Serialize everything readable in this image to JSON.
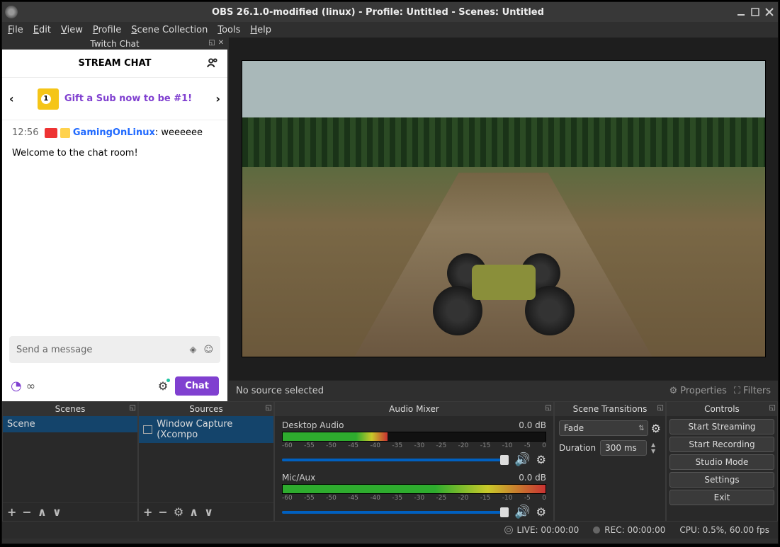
{
  "title": "OBS 26.1.0-modified (linux) - Profile: Untitled - Scenes: Untitled",
  "menu": {
    "file": "File",
    "edit": "Edit",
    "view": "View",
    "profile": "Profile",
    "scene": "Scene Collection",
    "tools": "Tools",
    "help": "Help"
  },
  "twitch": {
    "dock_title": "Twitch Chat",
    "header": "STREAM CHAT",
    "promo": "Gift a Sub now to be #1!",
    "msg_time": "12:56",
    "msg_user": "GamingOnLinux",
    "msg_text": ": weeeeee",
    "welcome": "Welcome to the chat room!",
    "input_ph": "Send a message",
    "chat_btn": "Chat",
    "infinity": "∞"
  },
  "srcbar": {
    "no_src": "No source selected",
    "props": "Properties",
    "filters": "Filters"
  },
  "panels": {
    "scenes": {
      "title": "Scenes",
      "item": "Scene"
    },
    "sources": {
      "title": "Sources",
      "item": "Window Capture (Xcompo"
    },
    "mixer": {
      "title": "Audio Mixer",
      "desktop": "Desktop Audio",
      "mic": "Mic/Aux",
      "db": "0.0 dB",
      "ticks": [
        "-60",
        "-55",
        "-50",
        "-45",
        "-40",
        "-35",
        "-30",
        "-25",
        "-20",
        "-15",
        "-10",
        "-5",
        "0"
      ]
    },
    "trans": {
      "title": "Scene Transitions",
      "type": "Fade",
      "dur_lbl": "Duration",
      "dur_val": "300 ms"
    },
    "ctrls": {
      "title": "Controls",
      "b1": "Start Streaming",
      "b2": "Start Recording",
      "b3": "Studio Mode",
      "b4": "Settings",
      "b5": "Exit"
    }
  },
  "status": {
    "live": "LIVE: 00:00:00",
    "rec": "REC: 00:00:00",
    "cpu": "CPU: 0.5%, 60.00 fps"
  }
}
